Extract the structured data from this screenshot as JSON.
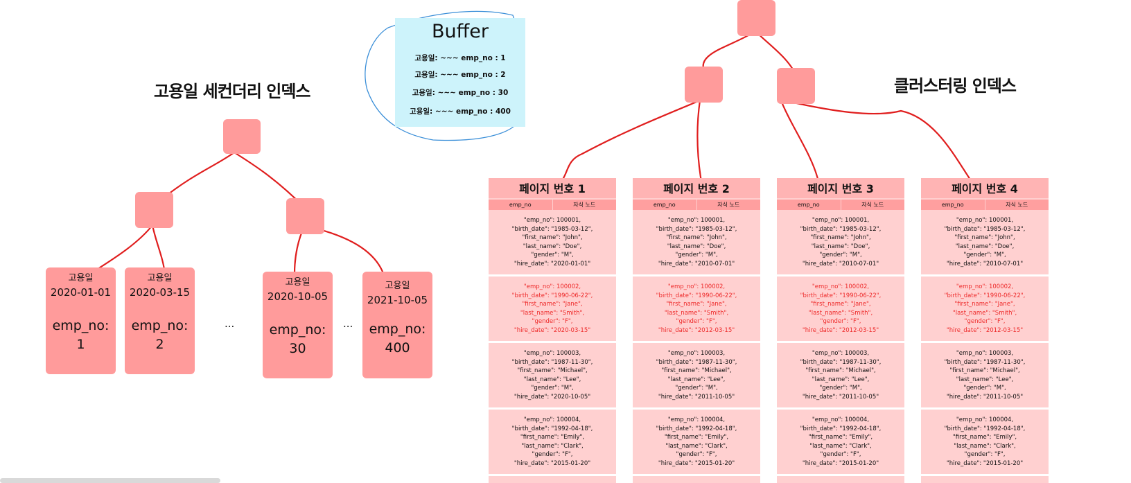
{
  "titles": {
    "secondary": "고용일 세컨더리 인덱스",
    "clustering": "클러스터링 인덱스"
  },
  "secondary_leaves": [
    {
      "label": "고용일",
      "date": "2020-01-01",
      "emp_label": "emp_no:",
      "emp_value": "1"
    },
    {
      "label": "고용일",
      "date": "2020-03-15",
      "emp_label": "emp_no:",
      "emp_value": "2"
    },
    {
      "label": "고용일",
      "date": "2020-10-05",
      "emp_label": "emp_no:",
      "emp_value": "30"
    },
    {
      "label": "고용일",
      "date": "2021-10-05",
      "emp_label": "emp_no:",
      "emp_value": "400"
    }
  ],
  "ellipsis": "...",
  "buffer": {
    "title": "Buffer",
    "rows": [
      "고용일: ~~~ emp_no : 1",
      "고용일: ~~~ emp_no : 2",
      "고용일: ~~~ emp_no : 30",
      "고용일: ~~~ emp_no : 400"
    ]
  },
  "page_columns": [
    "emp_no",
    "자식 노드"
  ],
  "pages": [
    {
      "title": "페이지 번호 1",
      "records": [
        [
          "\"emp_no\": 100001,",
          "\"birth_date\": \"1985-03-12\",",
          "\"first_name\": \"John\",",
          "\"last_name\": \"Doe\",",
          "\"gender\": \"M\",",
          "\"hire_date\": \"2020-01-01\""
        ],
        [
          "\"emp_no\": 100002,",
          "\"birth_date\": \"1990-06-22\",",
          "\"first_name\": \"Jane\",",
          "\"last_name\": \"Smith\",",
          "\"gender\": \"F\",",
          "\"hire_date\": \"2020-03-15\""
        ],
        [
          "\"emp_no\": 100003,",
          "\"birth_date\": \"1987-11-30\",",
          "\"first_name\": \"Michael\",",
          "\"last_name\": \"Lee\",",
          "\"gender\": \"M\",",
          "\"hire_date\": \"2020-10-05\""
        ],
        [
          "\"emp_no\": 100004,",
          "\"birth_date\": \"1992-04-18\",",
          "\"first_name\": \"Emily\",",
          "\"last_name\": \"Clark\",",
          "\"gender\": \"F\",",
          "\"hire_date\": \"2015-01-20\""
        ]
      ]
    },
    {
      "title": "페이지 번호 2",
      "records": [
        [
          "\"emp_no\": 100001,",
          "\"birth_date\": \"1985-03-12\",",
          "\"first_name\": \"John\",",
          "\"last_name\": \"Doe\",",
          "\"gender\": \"M\",",
          "\"hire_date\": \"2010-07-01\""
        ],
        [
          "\"emp_no\": 100002,",
          "\"birth_date\": \"1990-06-22\",",
          "\"first_name\": \"Jane\",",
          "\"last_name\": \"Smith\",",
          "\"gender\": \"F\",",
          "\"hire_date\": \"2012-03-15\""
        ],
        [
          "\"emp_no\": 100003,",
          "\"birth_date\": \"1987-11-30\",",
          "\"first_name\": \"Michael\",",
          "\"last_name\": \"Lee\",",
          "\"gender\": \"M\",",
          "\"hire_date\": \"2011-10-05\""
        ],
        [
          "\"emp_no\": 100004,",
          "\"birth_date\": \"1992-04-18\",",
          "\"first_name\": \"Emily\",",
          "\"last_name\": \"Clark\",",
          "\"gender\": \"F\",",
          "\"hire_date\": \"2015-01-20\""
        ]
      ]
    },
    {
      "title": "페이지 번호 3",
      "records": [
        [
          "\"emp_no\": 100001,",
          "\"birth_date\": \"1985-03-12\",",
          "\"first_name\": \"John\",",
          "\"last_name\": \"Doe\",",
          "\"gender\": \"M\",",
          "\"hire_date\": \"2010-07-01\""
        ],
        [
          "\"emp_no\": 100002,",
          "\"birth_date\": \"1990-06-22\",",
          "\"first_name\": \"Jane\",",
          "\"last_name\": \"Smith\",",
          "\"gender\": \"F\",",
          "\"hire_date\": \"2012-03-15\""
        ],
        [
          "\"emp_no\": 100003,",
          "\"birth_date\": \"1987-11-30\",",
          "\"first_name\": \"Michael\",",
          "\"last_name\": \"Lee\",",
          "\"gender\": \"M\",",
          "\"hire_date\": \"2011-10-05\""
        ],
        [
          "\"emp_no\": 100004,",
          "\"birth_date\": \"1992-04-18\",",
          "\"first_name\": \"Emily\",",
          "\"last_name\": \"Clark\",",
          "\"gender\": \"F\",",
          "\"hire_date\": \"2015-01-20\""
        ]
      ]
    },
    {
      "title": "페이지 번호 4",
      "records": [
        [
          "\"emp_no\": 100001,",
          "\"birth_date\": \"1985-03-12\",",
          "\"first_name\": \"John\",",
          "\"last_name\": \"Doe\",",
          "\"gender\": \"M\",",
          "\"hire_date\": \"2010-07-01\""
        ],
        [
          "\"emp_no\": 100002,",
          "\"birth_date\": \"1990-06-22\",",
          "\"first_name\": \"Jane\",",
          "\"last_name\": \"Smith\",",
          "\"gender\": \"F\",",
          "\"hire_date\": \"2012-03-15\""
        ],
        [
          "\"emp_no\": 100003,",
          "\"birth_date\": \"1987-11-30\",",
          "\"first_name\": \"Michael\",",
          "\"last_name\": \"Lee\",",
          "\"gender\": \"M\",",
          "\"hire_date\": \"2011-10-05\""
        ],
        [
          "\"emp_no\": 100004,",
          "\"birth_date\": \"1992-04-18\",",
          "\"first_name\": \"Emily\",",
          "\"last_name\": \"Clark\",",
          "\"gender\": \"F\",",
          "\"hire_date\": \"2015-01-20\""
        ]
      ]
    }
  ],
  "highlight_record_index": 1,
  "colors": {
    "node": "#ff9b9b",
    "page_header": "#ffb4b4",
    "page_body": "#ffd0d0",
    "page_columns": "#ff9f9f",
    "link": "#e01e1e",
    "highlight_text": "#ee2a2a",
    "buffer_bg": "#cdf3fb",
    "buffer_outline": "#3b8fd8"
  }
}
